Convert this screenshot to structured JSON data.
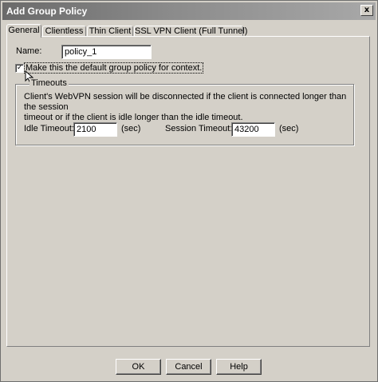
{
  "window": {
    "title": "Add Group Policy",
    "close_glyph": "x"
  },
  "tabs": [
    {
      "label": "General",
      "active": true
    },
    {
      "label": "Clientless",
      "active": false
    },
    {
      "label": "Thin Client",
      "active": false
    },
    {
      "label": "SSL VPN Client (Full Tunnel)",
      "active": false
    }
  ],
  "general": {
    "name_label": "Name:",
    "name_value": "policy_1",
    "default_checkbox_checked": true,
    "default_checkbox_label": "Make this the default group policy for context.",
    "timeouts": {
      "legend": "Timeouts",
      "description_line1": "Client's WebVPN session will be disconnected if the client is connected longer than the session",
      "description_line2": "timeout or if the client is idle longer than the idle timeout.",
      "idle_timeout_label": "Idle Timeout:",
      "idle_timeout_value": "2100",
      "idle_unit": "(sec)",
      "session_timeout_label": "Session Timeout:",
      "session_timeout_value": "43200",
      "session_unit": "(sec)"
    }
  },
  "buttons": {
    "ok": "OK",
    "cancel": "Cancel",
    "help": "Help"
  },
  "colors": {
    "face": "#d4d0c8",
    "title_bar": "#7a7a7a"
  }
}
